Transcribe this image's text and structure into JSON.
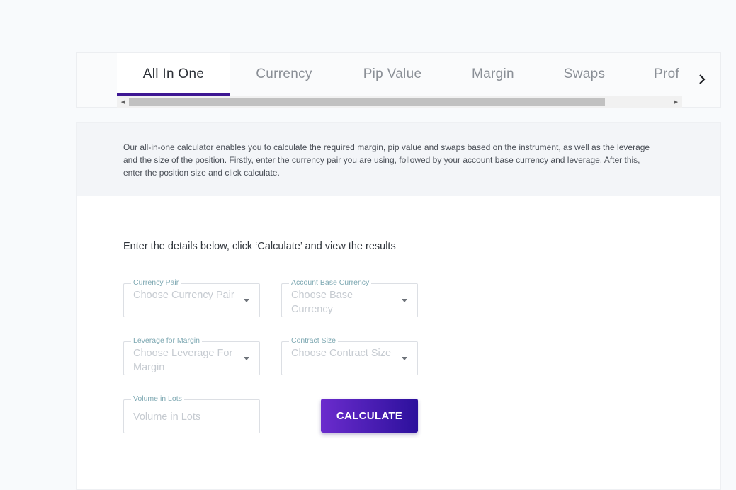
{
  "tabs": [
    {
      "label": "All In One",
      "active": true
    },
    {
      "label": "Currency",
      "active": false
    },
    {
      "label": "Pip Value",
      "active": false
    },
    {
      "label": "Margin",
      "active": false
    },
    {
      "label": "Swaps",
      "active": false
    },
    {
      "label": "Prof",
      "active": false
    }
  ],
  "tabs_next_icon": "chevron-right-icon",
  "intro": "Our all-in-one calculator enables you to calculate the required margin, pip value and swaps based on the instrument, as well as the leverage and the size of the position. Firstly, enter the currency pair you are using, followed by your account base currency and leverage. After this, enter the position size and click calculate.",
  "form": {
    "instructions": "Enter the details below, click ‘Calculate’ and view the results",
    "currency_pair": {
      "label": "Currency Pair",
      "placeholder": "Choose Currency Pair"
    },
    "account_base_currency": {
      "label": "Account Base Currency",
      "placeholder": "Choose Base Currency"
    },
    "leverage": {
      "label": "Leverage for Margin",
      "placeholder": "Choose Leverage For Margin"
    },
    "contract_size": {
      "label": "Contract Size",
      "placeholder": "Choose Contract Size"
    },
    "volume": {
      "label": "Volume in Lots",
      "placeholder": "Volume in Lots"
    },
    "calculate_label": "CALCULATE"
  },
  "colors": {
    "accent": "#3e1793",
    "button_start": "#6b2ccd",
    "button_end": "#2c109c",
    "field_label": "#7fa9b3",
    "placeholder": "#c6cbd1"
  }
}
